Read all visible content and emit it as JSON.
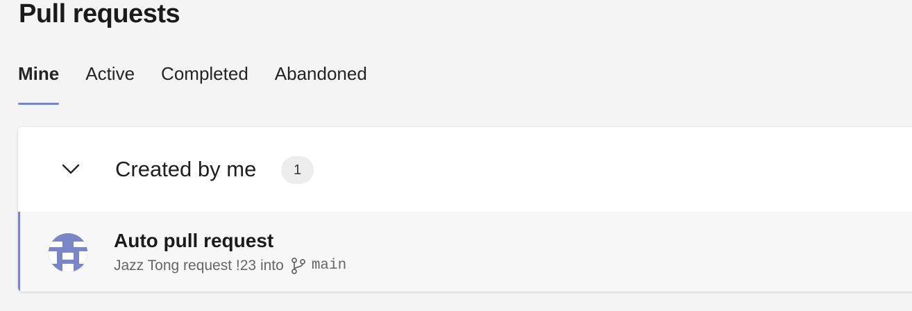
{
  "page": {
    "title": "Pull requests"
  },
  "tabs": [
    {
      "label": "Mine",
      "active": true
    },
    {
      "label": "Active",
      "active": false
    },
    {
      "label": "Completed",
      "active": false
    },
    {
      "label": "Abandoned",
      "active": false
    }
  ],
  "group": {
    "title": "Created by me",
    "count": "1",
    "expanded": true,
    "toggle_icon": "chevron-down-icon"
  },
  "pull_requests": [
    {
      "title": "Auto pull request",
      "author": "Jazz Tong",
      "request_word": "request",
      "id": "!23",
      "into_word": "into",
      "branch_icon": "branch-icon",
      "target_branch": "main",
      "avatar_icon": "avatar"
    }
  ],
  "colors": {
    "accent": "#7a85c9",
    "avatar": "#7b86c8",
    "background": "#f4f4f4",
    "card": "#ffffff"
  }
}
